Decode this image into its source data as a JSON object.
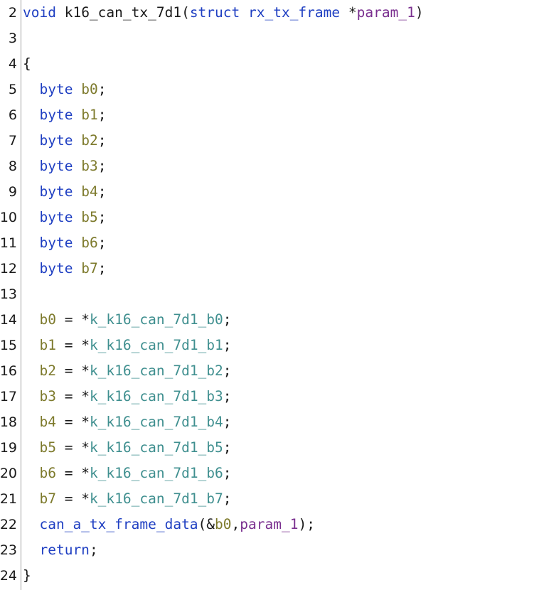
{
  "lines": [
    {
      "n": "2",
      "tokens": [
        {
          "t": "void",
          "c": "kw"
        },
        {
          "t": " k16_can_tx_7d1(",
          "c": "pun"
        },
        {
          "t": "struct rx_tx_frame",
          "c": "kw"
        },
        {
          "t": " *",
          "c": "pun"
        },
        {
          "t": "param_1",
          "c": "par"
        },
        {
          "t": ")",
          "c": "pun"
        }
      ]
    },
    {
      "n": "3",
      "tokens": []
    },
    {
      "n": "4",
      "tokens": [
        {
          "t": "{",
          "c": "pun"
        }
      ]
    },
    {
      "n": "5",
      "tokens": [
        {
          "t": "  ",
          "c": "pun"
        },
        {
          "t": "byte",
          "c": "kw"
        },
        {
          "t": " ",
          "c": "pun"
        },
        {
          "t": "b0",
          "c": "var"
        },
        {
          "t": ";",
          "c": "pun"
        }
      ]
    },
    {
      "n": "6",
      "tokens": [
        {
          "t": "  ",
          "c": "pun"
        },
        {
          "t": "byte",
          "c": "kw"
        },
        {
          "t": " ",
          "c": "pun"
        },
        {
          "t": "b1",
          "c": "var"
        },
        {
          "t": ";",
          "c": "pun"
        }
      ]
    },
    {
      "n": "7",
      "tokens": [
        {
          "t": "  ",
          "c": "pun"
        },
        {
          "t": "byte",
          "c": "kw"
        },
        {
          "t": " ",
          "c": "pun"
        },
        {
          "t": "b2",
          "c": "var"
        },
        {
          "t": ";",
          "c": "pun"
        }
      ]
    },
    {
      "n": "8",
      "tokens": [
        {
          "t": "  ",
          "c": "pun"
        },
        {
          "t": "byte",
          "c": "kw"
        },
        {
          "t": " ",
          "c": "pun"
        },
        {
          "t": "b3",
          "c": "var"
        },
        {
          "t": ";",
          "c": "pun"
        }
      ]
    },
    {
      "n": "9",
      "tokens": [
        {
          "t": "  ",
          "c": "pun"
        },
        {
          "t": "byte",
          "c": "kw"
        },
        {
          "t": " ",
          "c": "pun"
        },
        {
          "t": "b4",
          "c": "var"
        },
        {
          "t": ";",
          "c": "pun"
        }
      ]
    },
    {
      "n": "10",
      "tokens": [
        {
          "t": "  ",
          "c": "pun"
        },
        {
          "t": "byte",
          "c": "kw"
        },
        {
          "t": " ",
          "c": "pun"
        },
        {
          "t": "b5",
          "c": "var"
        },
        {
          "t": ";",
          "c": "pun"
        }
      ]
    },
    {
      "n": "11",
      "tokens": [
        {
          "t": "  ",
          "c": "pun"
        },
        {
          "t": "byte",
          "c": "kw"
        },
        {
          "t": " ",
          "c": "pun"
        },
        {
          "t": "b6",
          "c": "var"
        },
        {
          "t": ";",
          "c": "pun"
        }
      ]
    },
    {
      "n": "12",
      "tokens": [
        {
          "t": "  ",
          "c": "pun"
        },
        {
          "t": "byte",
          "c": "kw"
        },
        {
          "t": " ",
          "c": "pun"
        },
        {
          "t": "b7",
          "c": "var"
        },
        {
          "t": ";",
          "c": "pun"
        }
      ]
    },
    {
      "n": "13",
      "tokens": []
    },
    {
      "n": "14",
      "tokens": [
        {
          "t": "  ",
          "c": "pun"
        },
        {
          "t": "b0",
          "c": "var"
        },
        {
          "t": " = *",
          "c": "pun"
        },
        {
          "t": "k_k16_can_7d1_b0",
          "c": "glb"
        },
        {
          "t": ";",
          "c": "pun"
        }
      ]
    },
    {
      "n": "15",
      "tokens": [
        {
          "t": "  ",
          "c": "pun"
        },
        {
          "t": "b1",
          "c": "var"
        },
        {
          "t": " = *",
          "c": "pun"
        },
        {
          "t": "k_k16_can_7d1_b1",
          "c": "glb"
        },
        {
          "t": ";",
          "c": "pun"
        }
      ]
    },
    {
      "n": "16",
      "tokens": [
        {
          "t": "  ",
          "c": "pun"
        },
        {
          "t": "b2",
          "c": "var"
        },
        {
          "t": " = *",
          "c": "pun"
        },
        {
          "t": "k_k16_can_7d1_b2",
          "c": "glb"
        },
        {
          "t": ";",
          "c": "pun"
        }
      ]
    },
    {
      "n": "17",
      "tokens": [
        {
          "t": "  ",
          "c": "pun"
        },
        {
          "t": "b3",
          "c": "var"
        },
        {
          "t": " = *",
          "c": "pun"
        },
        {
          "t": "k_k16_can_7d1_b3",
          "c": "glb"
        },
        {
          "t": ";",
          "c": "pun"
        }
      ]
    },
    {
      "n": "18",
      "tokens": [
        {
          "t": "  ",
          "c": "pun"
        },
        {
          "t": "b4",
          "c": "var"
        },
        {
          "t": " = *",
          "c": "pun"
        },
        {
          "t": "k_k16_can_7d1_b4",
          "c": "glb"
        },
        {
          "t": ";",
          "c": "pun"
        }
      ]
    },
    {
      "n": "19",
      "tokens": [
        {
          "t": "  ",
          "c": "pun"
        },
        {
          "t": "b5",
          "c": "var"
        },
        {
          "t": " = *",
          "c": "pun"
        },
        {
          "t": "k_k16_can_7d1_b5",
          "c": "glb"
        },
        {
          "t": ";",
          "c": "pun"
        }
      ]
    },
    {
      "n": "20",
      "tokens": [
        {
          "t": "  ",
          "c": "pun"
        },
        {
          "t": "b6",
          "c": "var"
        },
        {
          "t": " = *",
          "c": "pun"
        },
        {
          "t": "k_k16_can_7d1_b6",
          "c": "glb"
        },
        {
          "t": ";",
          "c": "pun"
        }
      ]
    },
    {
      "n": "21",
      "tokens": [
        {
          "t": "  ",
          "c": "pun"
        },
        {
          "t": "b7",
          "c": "var"
        },
        {
          "t": " = *",
          "c": "pun"
        },
        {
          "t": "k_k16_can_7d1_b7",
          "c": "glb"
        },
        {
          "t": ";",
          "c": "pun"
        }
      ]
    },
    {
      "n": "22",
      "tokens": [
        {
          "t": "  ",
          "c": "pun"
        },
        {
          "t": "can_a_tx_frame_data",
          "c": "kw"
        },
        {
          "t": "(&",
          "c": "pun"
        },
        {
          "t": "b0",
          "c": "var"
        },
        {
          "t": ",",
          "c": "pun"
        },
        {
          "t": "param_1",
          "c": "par"
        },
        {
          "t": ");",
          "c": "pun"
        }
      ]
    },
    {
      "n": "23",
      "tokens": [
        {
          "t": "  ",
          "c": "pun"
        },
        {
          "t": "return",
          "c": "kw"
        },
        {
          "t": ";",
          "c": "pun"
        }
      ]
    },
    {
      "n": "24",
      "tokens": [
        {
          "t": "}",
          "c": "pun"
        }
      ]
    }
  ],
  "colors": {
    "keyword": "#1f3fc2",
    "local_variable": "#7d7a2c",
    "global_symbol": "#3f8f8f",
    "parameter": "#7a2f8f",
    "text": "#1a1a1a"
  }
}
